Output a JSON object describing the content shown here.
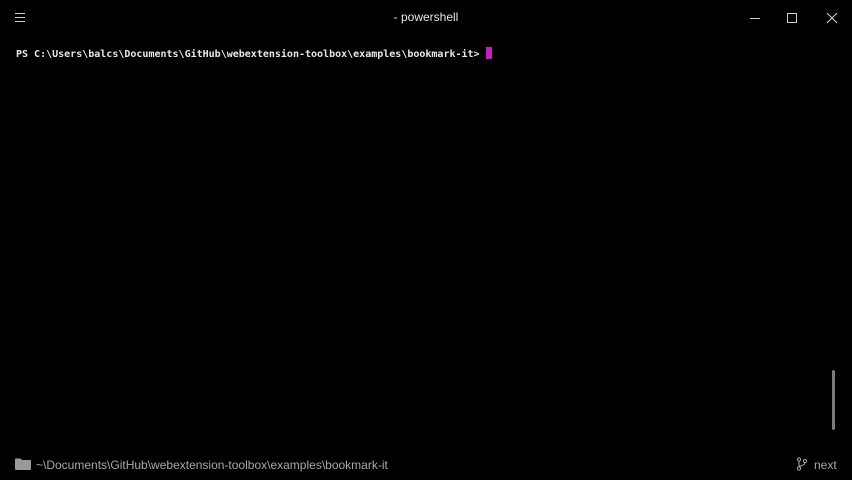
{
  "window": {
    "title": "- powershell"
  },
  "icons": {
    "menu": "hamburger-menu-icon",
    "minimize": "minimize-icon",
    "maximize": "maximize-icon",
    "close": "close-icon",
    "folder": "folder-icon",
    "branch": "git-branch-icon"
  },
  "terminal": {
    "prompt": "PS C:\\Users\\balcs\\Documents\\GitHub\\webextension-toolbox\\examples\\bookmark-it>",
    "cursor_color": "#c31fbb"
  },
  "statusbar": {
    "path": "~\\Documents\\GitHub\\webextension-toolbox\\examples\\bookmark-it",
    "branch": "next"
  }
}
